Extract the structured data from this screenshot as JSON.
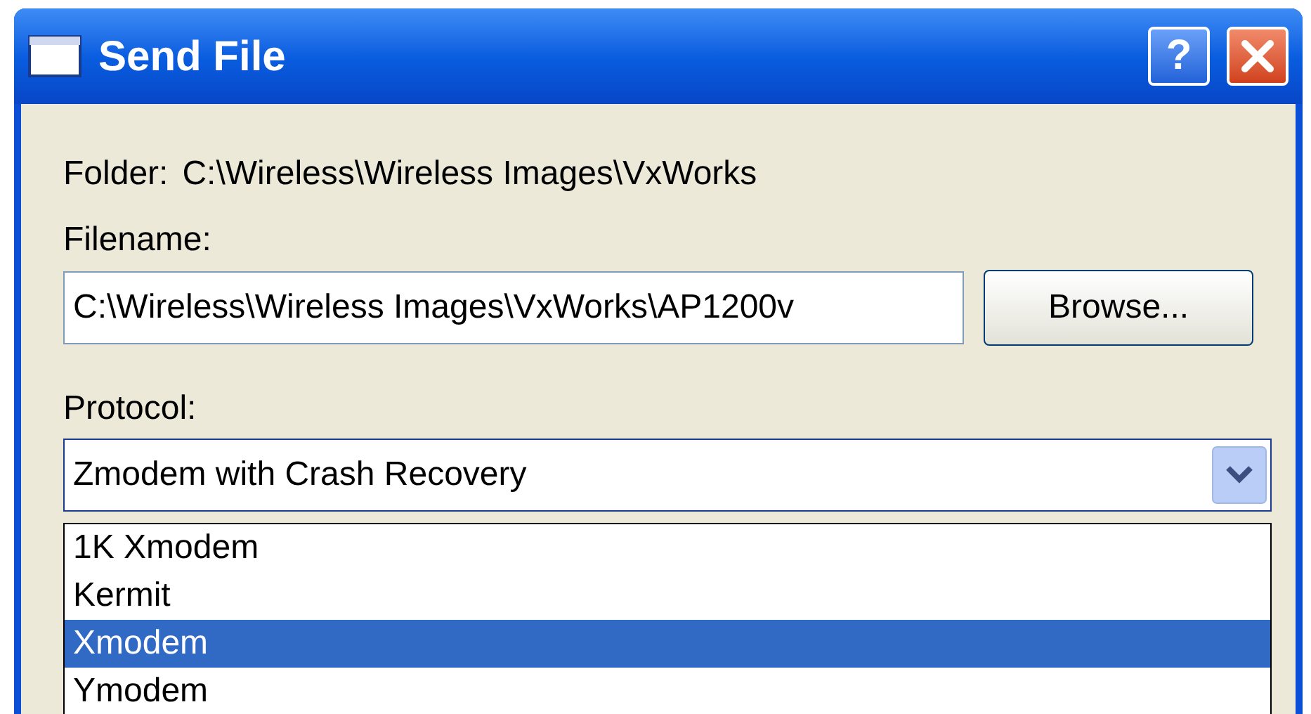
{
  "window": {
    "title": "Send File",
    "buttons": [
      {
        "kind": "help",
        "label": "?"
      },
      {
        "kind": "close"
      }
    ]
  },
  "folder": {
    "label": "Folder:",
    "value": "C:\\Wireless\\Wireless Images\\VxWorks"
  },
  "filename": {
    "label": "Filename:",
    "value": "C:\\Wireless\\Wireless Images\\VxWorks\\AP1200v",
    "browse": "Browse..."
  },
  "protocol": {
    "label": "Protocol:",
    "value": "Zmodem with Crash Recovery",
    "expanded": true,
    "options": [
      {
        "label": "1K Xmodem",
        "selected": false
      },
      {
        "label": "Kermit",
        "selected": false
      },
      {
        "label": "Xmodem",
        "selected": true
      },
      {
        "label": "Ymodem",
        "selected": false
      }
    ]
  }
}
